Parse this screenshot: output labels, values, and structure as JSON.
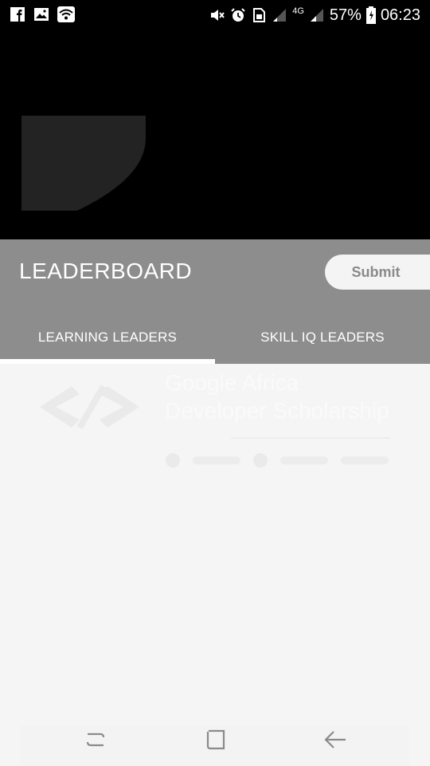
{
  "status_bar": {
    "left_icons": [
      "facebook-icon",
      "image-icon",
      "wifi-icon"
    ],
    "right_icons": [
      "mute-icon",
      "alarm-icon",
      "sim-icon",
      "signal-icon",
      "signal-4g-icon",
      "signal-icon",
      "battery-icon"
    ],
    "network_label": "4G",
    "battery": "57%",
    "time": "06:23"
  },
  "header": {
    "title": "LEADERBOARD",
    "submit_label": "Submit",
    "tabs": [
      {
        "label": "LEARNING LEADERS",
        "active": true
      },
      {
        "label": "SKILL IQ LEADERS",
        "active": false
      }
    ],
    "background_color": "#8d8d8d"
  },
  "content": {
    "banner_title_line1": "Google Africa",
    "banner_title_line2": "Developer Scholarship"
  },
  "nav_bar": {
    "buttons": [
      "recents-icon",
      "home-icon",
      "back-icon"
    ]
  }
}
